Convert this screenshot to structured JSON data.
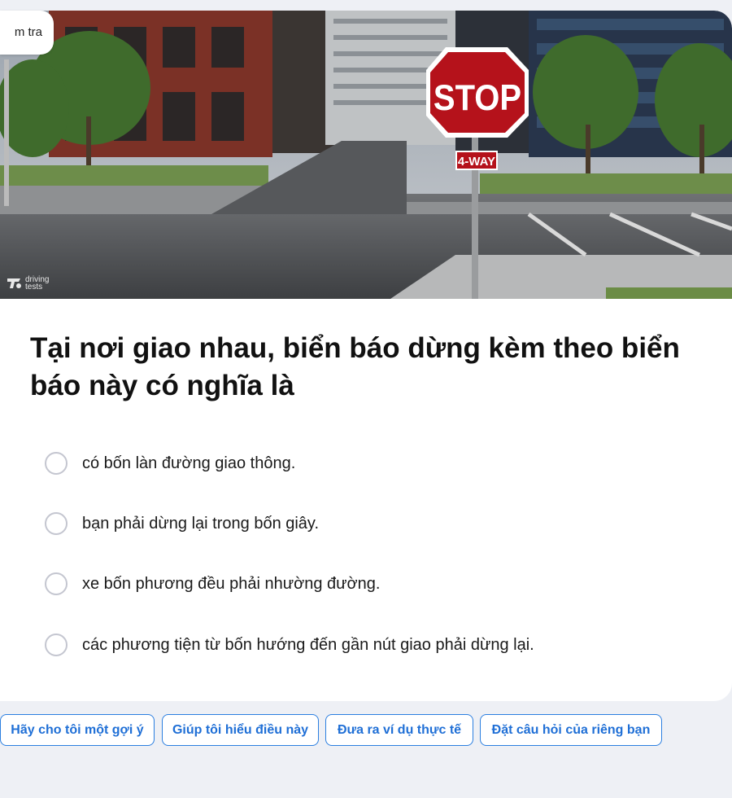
{
  "badge": {
    "label": "m tra"
  },
  "scene": {
    "sign_text": "STOP",
    "plate_text": "4-WAY",
    "watermark": {
      "line1": "driving",
      "line2": "tests"
    }
  },
  "question": {
    "text": "Tại nơi giao nhau, biển báo dừng kèm theo biển báo này có nghĩa là"
  },
  "options": [
    {
      "label": "có bốn làn đường giao thông."
    },
    {
      "label": "bạn phải dừng lại trong bốn giây."
    },
    {
      "label": "xe bốn phương đều phải nhường đường."
    },
    {
      "label": "các phương tiện từ bốn hướng đến gần nút giao phải dừng lại."
    }
  ],
  "actions": [
    {
      "label": "Hãy cho tôi một gợi ý"
    },
    {
      "label": "Giúp tôi hiểu điều này"
    },
    {
      "label": "Đưa ra ví dụ thực tế"
    },
    {
      "label": "Đặt câu hỏi của riêng bạn"
    }
  ],
  "colors": {
    "page_bg": "#eef0f5",
    "accent": "#1f6fd6",
    "sign_red": "#b5121b"
  }
}
